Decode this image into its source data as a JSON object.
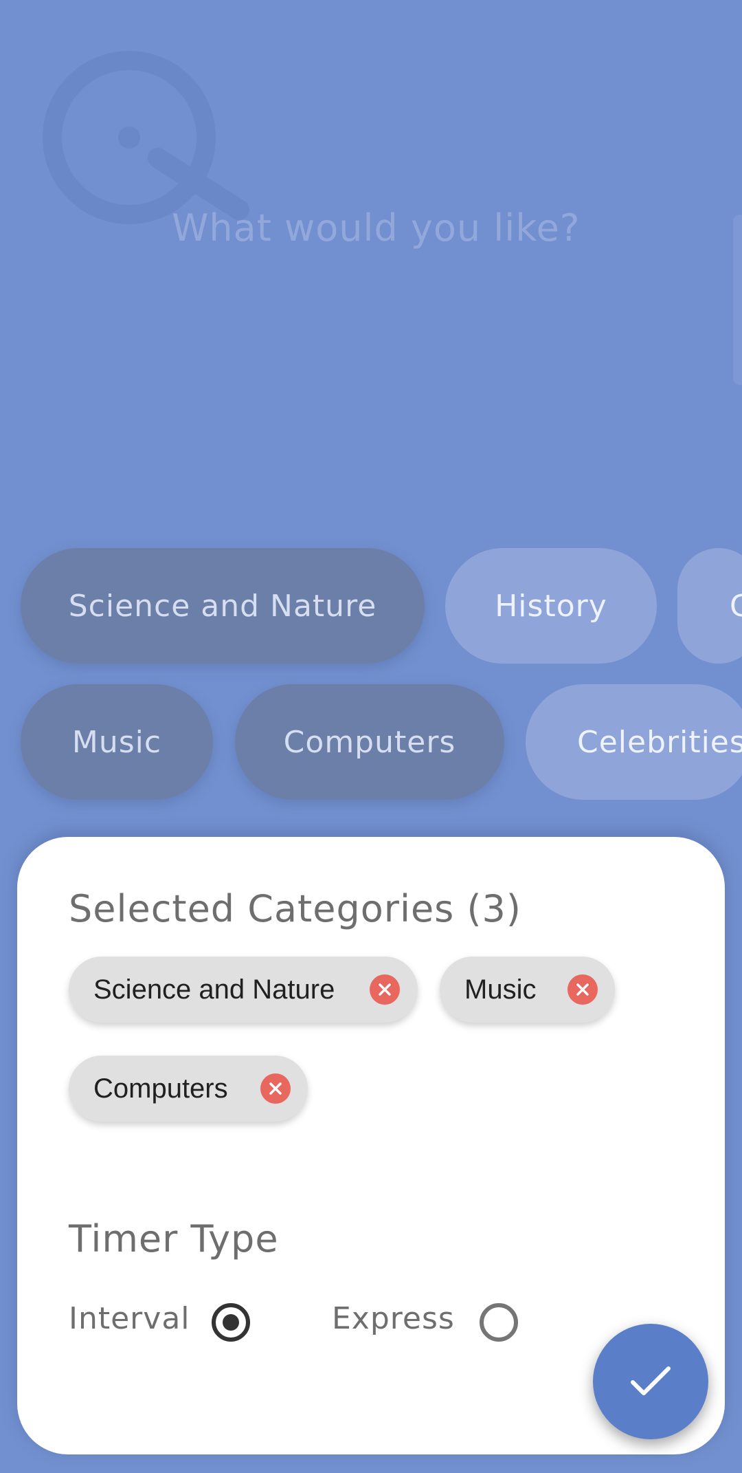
{
  "colors": {
    "background": "#7290cf",
    "fab": "#5b7ec9",
    "remove_icon": "#e8675f",
    "selected_chip": "#6b7fa8",
    "unselected_chip": "#8fa5da"
  },
  "search": {
    "prompt": "What would you like?",
    "icon": "search-logo-icon"
  },
  "categories": {
    "row1": [
      "Science and Nature",
      "History",
      "G"
    ],
    "row2": [
      "Music",
      "Computers",
      "Celebrities"
    ]
  },
  "sheet": {
    "title": "Selected Categories (3)",
    "selected": [
      "Science and Nature",
      "Music",
      "Computers"
    ],
    "remove_icon": "close-circle-icon",
    "timer_title": "Timer Type",
    "timer_options": [
      {
        "label": "Interval",
        "checked": true
      },
      {
        "label": "Express",
        "checked": false
      }
    ],
    "confirm_icon": "check-icon"
  }
}
